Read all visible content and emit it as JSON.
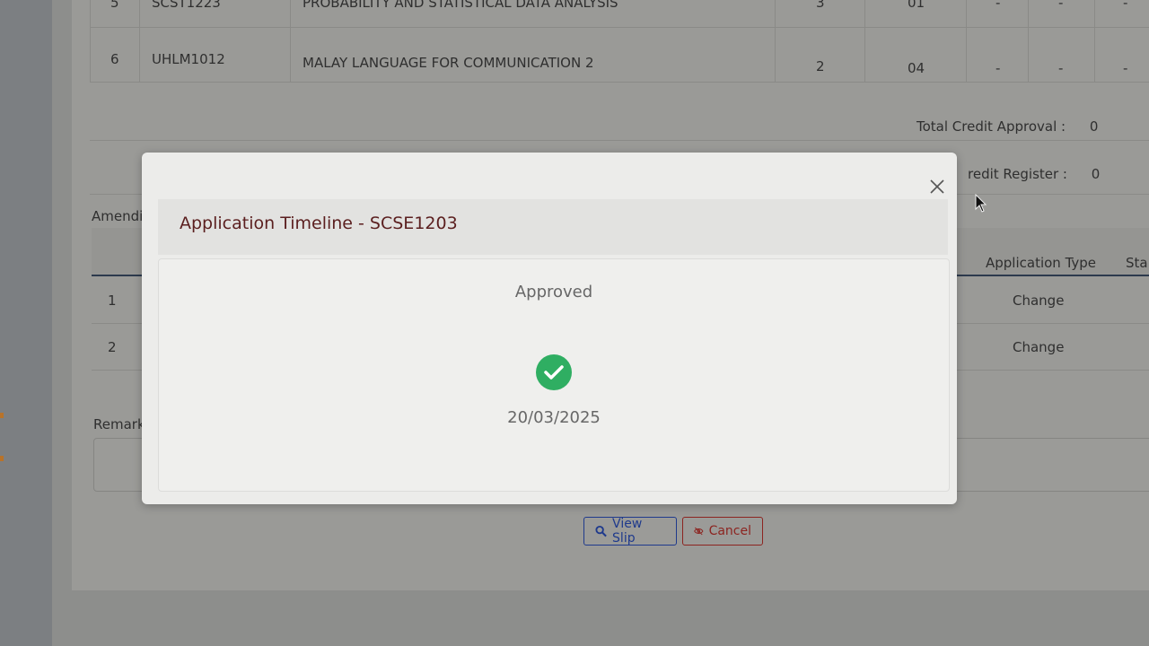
{
  "courses": [
    {
      "no": "5",
      "code": "SCST1223",
      "name": "PROBABILITY AND STATISTICAL DATA ANALYSIS",
      "credit": "3",
      "section": "01",
      "c1": "-",
      "c2": "-",
      "c3": "-"
    },
    {
      "no": "6",
      "code": "UHLM1012",
      "name": "MALAY LANGUAGE FOR COMMUNICATION 2",
      "credit": "2",
      "section": "04",
      "c1": "-",
      "c2": "-",
      "c3": "-"
    }
  ],
  "summary": {
    "total_credit_approval_label": "Total Credit Approval :",
    "total_credit_approval_value": "0",
    "credit_register_label": "redit Register :",
    "credit_register_value": "0"
  },
  "amendment": {
    "label": "Amendi",
    "headers": {
      "application_type": "Application Type",
      "status": "Sta"
    },
    "rows": [
      {
        "index": "1",
        "application_type": "Change"
      },
      {
        "index": "2",
        "application_type": "Change"
      }
    ]
  },
  "remark": {
    "label": "Remark"
  },
  "buttons": {
    "view_slip": "View Slip",
    "cancel": "Cancel"
  },
  "modal": {
    "title": "Application Timeline - SCSE1203",
    "timeline": {
      "status": "Approved",
      "date": "20/03/2025"
    }
  },
  "icons": {
    "close": "close-icon",
    "check": "check-circle-icon",
    "search": "search-icon",
    "eye_slash": "eye-slash-icon",
    "cursor": "mouse-cursor-icon"
  },
  "colors": {
    "modal_title": "#5b1f1f",
    "approved_green": "#2fae62",
    "view_slip_blue": "#1f3a8c",
    "cancel_red": "#8c2420"
  }
}
